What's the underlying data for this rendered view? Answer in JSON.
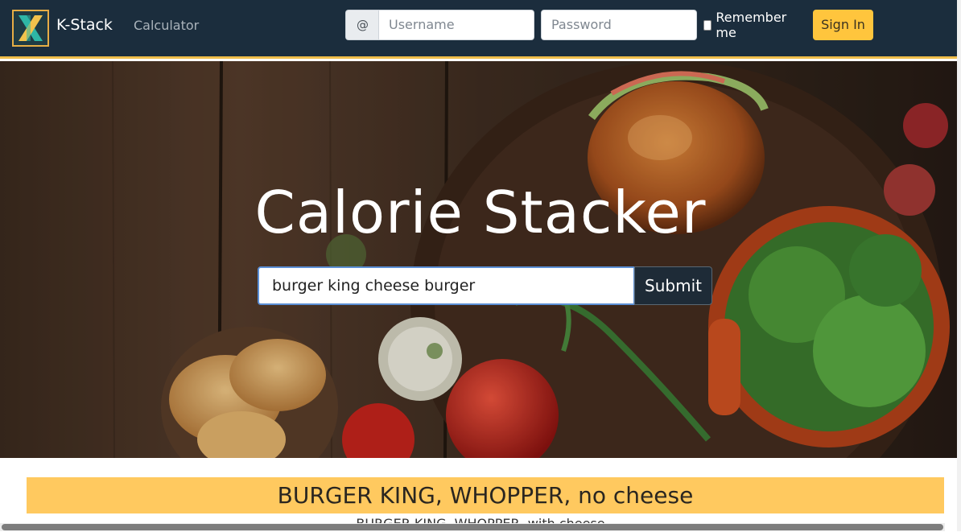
{
  "navbar": {
    "brand_name": "K-Stack",
    "nav_link": "Calculator",
    "login": {
      "at_symbol": "@",
      "username_placeholder": "Username",
      "password_placeholder": "Password",
      "remember_label": "Remember me",
      "remember_checked": false,
      "signin_label": "Sign In"
    },
    "colors": {
      "bg": "#1b2d3d",
      "accent": "#f0be4b",
      "signin": "#ffc53d"
    }
  },
  "hero": {
    "title": "Calorie Stacker",
    "search_value": "burger king cheese burger",
    "submit_label": "Submit"
  },
  "results": {
    "top_result": "BURGER KING, WHOPPER, no cheese",
    "next_result": "BURGER KING, WHOPPER, with cheese",
    "highlight_color": "#ffc95f"
  }
}
